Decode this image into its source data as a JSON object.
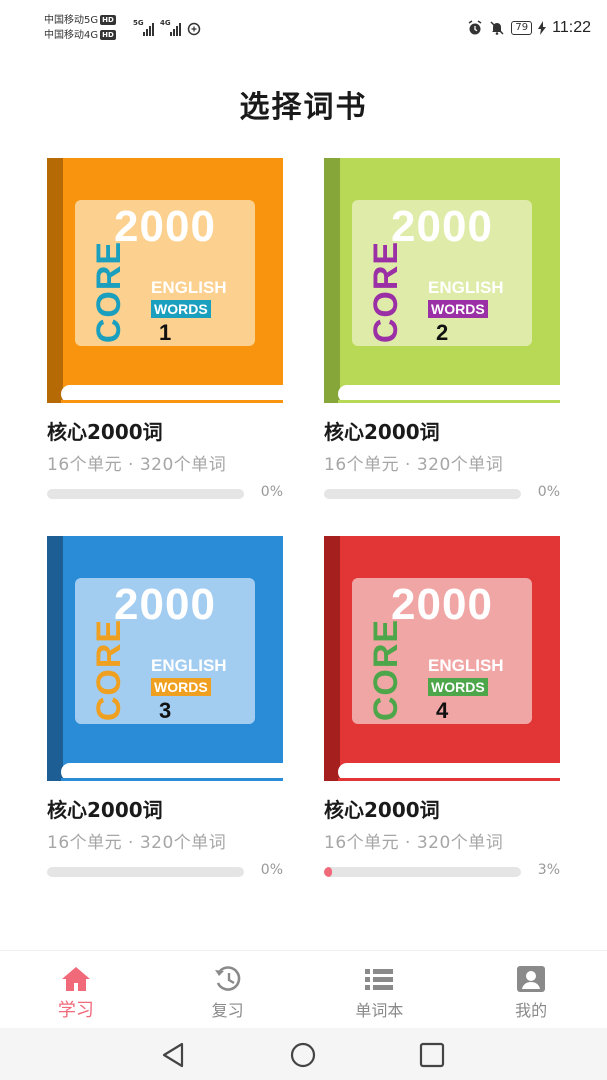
{
  "status_bar": {
    "carrier_1": "中国移动5G",
    "carrier_2": "中国移动4G",
    "hd": "HD",
    "sig1_tag": "5G",
    "sig2_tag": "4G",
    "battery": "79",
    "time": "11:22"
  },
  "page_title": "选择词书",
  "cover_text": {
    "number": "2000",
    "core": "CORE",
    "english": "ENGLISH",
    "words": "WORDS"
  },
  "books": [
    {
      "index": "1",
      "title": "核心2000词",
      "meta": "16个单元 · 320个单词",
      "progress_text": "0%",
      "progress": 0,
      "colors": {
        "cover": "#f9940e",
        "spine": "#b66a05",
        "panel": "#fcd08e",
        "core": "#1a9fbf",
        "words_bg": "#1a9fbf"
      }
    },
    {
      "index": "2",
      "title": "核心2000词",
      "meta": "16个单元 · 320个单词",
      "progress_text": "0%",
      "progress": 0,
      "colors": {
        "cover": "#b8d955",
        "spine": "#86a63a",
        "panel": "#dfeba8",
        "core": "#9b2fa5",
        "words_bg": "#9b2fa5"
      }
    },
    {
      "index": "3",
      "title": "核心2000词",
      "meta": "16个单元 · 320个单词",
      "progress_text": "0%",
      "progress": 0,
      "colors": {
        "cover": "#2a8bd6",
        "spine": "#1d5e94",
        "panel": "#a2cdf1",
        "core": "#f0a020",
        "words_bg": "#f0a020"
      }
    },
    {
      "index": "4",
      "title": "核心2000词",
      "meta": "16个单元 · 320个单词",
      "progress_text": "3%",
      "progress": 0.03,
      "colors": {
        "cover": "#e23535",
        "spine": "#a51f1f",
        "panel": "#f1a6a6",
        "core": "#4ea64a",
        "words_bg": "#4ea64a"
      }
    }
  ],
  "tabs": [
    {
      "label": "学习",
      "icon": "home-icon",
      "active": true
    },
    {
      "label": "复习",
      "icon": "history-icon",
      "active": false
    },
    {
      "label": "单词本",
      "icon": "list-icon",
      "active": false
    },
    {
      "label": "我的",
      "icon": "profile-icon",
      "active": false
    }
  ],
  "theme": {
    "accent": "#f06a7a",
    "inactive": "#8a8a8a"
  }
}
